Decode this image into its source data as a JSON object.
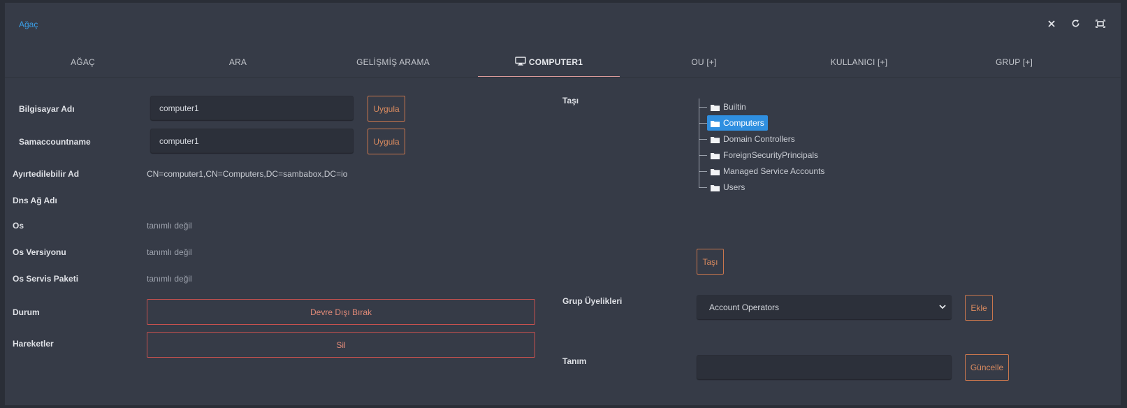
{
  "header": {
    "title": "Ağaç"
  },
  "window_icons": [
    "close-icon",
    "refresh-icon",
    "maximize-icon"
  ],
  "tabs": [
    {
      "label": "AĞAÇ",
      "active": false
    },
    {
      "label": "ARA",
      "active": false
    },
    {
      "label": "GELİŞMİŞ ARAMA",
      "active": false
    },
    {
      "label": "COMPUTER1",
      "active": true,
      "icon": "monitor-icon"
    },
    {
      "label": "OU [+]",
      "active": false
    },
    {
      "label": "KULLANICI [+]",
      "active": false
    },
    {
      "label": "GRUP [+]",
      "active": false
    }
  ],
  "left": {
    "computer_name_label": "Bilgisayar Adı",
    "computer_name_value": "computer1",
    "apply_label": "Uygula",
    "samaccountname_label": "Samaccountname",
    "samaccountname_value": "computer1",
    "dn_label": "Ayırtedilebilir Ad",
    "dn_value": "CN=computer1,CN=Computers,DC=sambabox,DC=io",
    "dns_label": "Dns Ağ Adı",
    "dns_value": "",
    "os_label": "Os",
    "os_value": "tanımlı değil",
    "os_version_label": "Os Versiyonu",
    "os_version_value": "tanımlı değil",
    "os_sp_label": "Os Servis Paketi",
    "os_sp_value": "tanımlı değil",
    "status_label": "Durum",
    "disable_label": "Devre Dışı Bırak",
    "actions_label": "Hareketler",
    "delete_label": "Sil"
  },
  "right": {
    "move_label": "Taşı",
    "tree": [
      "Builtin",
      "Computers",
      "Domain Controllers",
      "ForeignSecurityPrincipals",
      "Managed Service Accounts",
      "Users"
    ],
    "tree_selected": "Computers",
    "move_button": "Taşı",
    "group_label": "Grup Üyelikleri",
    "group_selected": "Account Operators",
    "add_button": "Ekle",
    "desc_label": "Tanım",
    "desc_value": "",
    "update_button": "Güncelle"
  },
  "colors": {
    "accent": "#2f8fe0",
    "button_border": "#c8764d",
    "danger_border": "#c6514f",
    "panel": "#363b47"
  }
}
